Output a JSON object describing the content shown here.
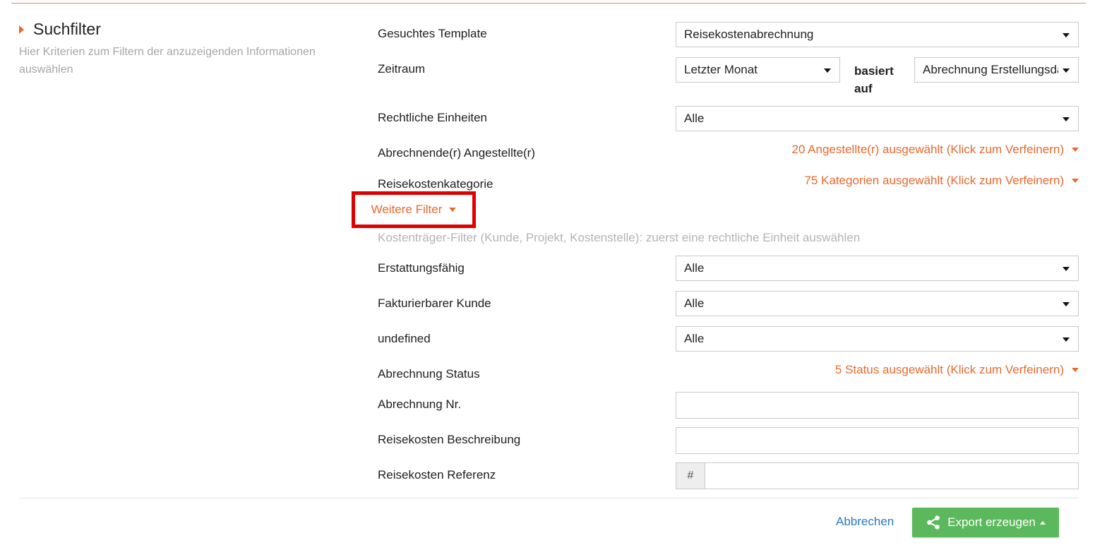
{
  "section": {
    "title": "Suchfilter",
    "subtitle": "Hier Kriterien zum Filtern der anzuzeigenden Informationen auswählen"
  },
  "fields": {
    "template": {
      "label": "Gesuchtes Template",
      "value": "Reisekostenabrechnung"
    },
    "zeitraum": {
      "label": "Zeitraum",
      "value": "Letzter Monat",
      "based_on_label": "basiert auf",
      "based_on_value": "Abrechnung Erstellungsdatum"
    },
    "rechtliche_einheiten": {
      "label": "Rechtliche Einheiten",
      "value": "Alle"
    },
    "angestellte": {
      "label": "Abrechnende(r) Angestellte(r)",
      "value": "20 Angestellte(r) ausgewählt (Klick zum Verfeinern)"
    },
    "kategorie": {
      "label": "Reisekostenkategorie",
      "value": "75 Kategorien ausgewählt (Klick zum Verfeinern)"
    },
    "weitere_filter": "Weitere Filter",
    "kostentraeger_hint": "Kostenträger-Filter (Kunde, Projekt, Kostenstelle): zuerst eine rechtliche Einheit auswählen",
    "erstattungsfaehig": {
      "label": "Erstattungsfähig",
      "value": "Alle"
    },
    "fakturierbarer_kunde": {
      "label": "Fakturierbarer Kunde",
      "value": "Alle"
    },
    "undefined_field": {
      "label": "undefined",
      "value": "Alle"
    },
    "status": {
      "label": "Abrechnung Status",
      "value": "5 Status ausgewählt (Klick zum Verfeinern)"
    },
    "abrechnung_nr": {
      "label": "Abrechnung Nr.",
      "value": ""
    },
    "beschreibung": {
      "label": "Reisekosten Beschreibung",
      "value": ""
    },
    "referenz": {
      "label": "Reisekosten Referenz",
      "prefix": "#",
      "value": ""
    }
  },
  "footer": {
    "cancel": "Abbrechen",
    "export": "Export erzeugen"
  },
  "colors": {
    "accent_orange": "#e8692e",
    "highlight_red": "#e00000",
    "button_green": "#5cb85c",
    "link_blue": "#2a78c2"
  }
}
